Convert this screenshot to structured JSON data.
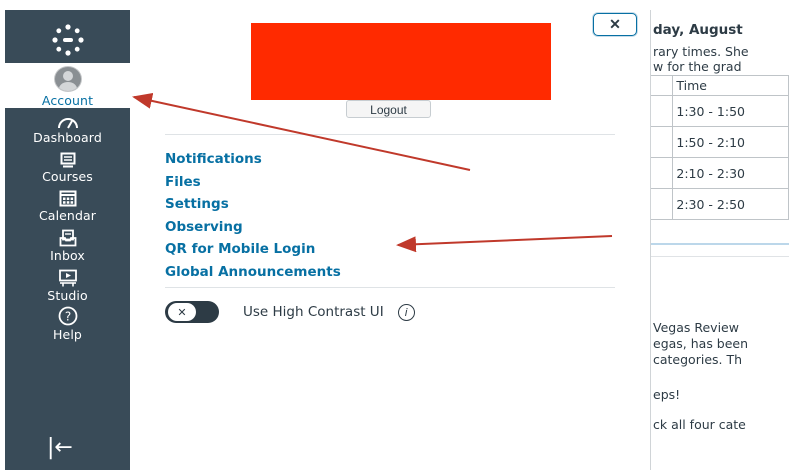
{
  "global_nav": {
    "items": [
      {
        "label": "Account",
        "icon": "account-avatar-icon"
      },
      {
        "label": "Dashboard",
        "icon": "dashboard-icon"
      },
      {
        "label": "Courses",
        "icon": "courses-icon"
      },
      {
        "label": "Calendar",
        "icon": "calendar-icon"
      },
      {
        "label": "Inbox",
        "icon": "inbox-icon"
      },
      {
        "label": "Studio",
        "icon": "studio-icon"
      },
      {
        "label": "Help",
        "icon": "help-icon"
      }
    ],
    "collapse_glyph": "|←"
  },
  "account_tray": {
    "logout_label": "Logout",
    "links": [
      "Notifications",
      "Files",
      "Settings",
      "Observing",
      "QR for Mobile Login",
      "Global Announcements"
    ],
    "high_contrast_label": "Use High Contrast UI",
    "toggle_knob": "✕",
    "info_glyph": "i"
  },
  "close_button": {
    "glyph": "✕"
  },
  "background_content": {
    "heading": "day, August",
    "line1": "rary times. She",
    "line2": "w for the grad",
    "table_header": "Time",
    "table_rows": [
      "1:30 - 1:50",
      "1:50 - 2:10",
      "2:10 - 2:30",
      "2:30 - 2:50"
    ],
    "para_title": "Vegas Review",
    "para_line1": "egas, has been",
    "para_line2": "categories. Th",
    "para_line3": "eps!",
    "para_line4": "ck all four cate"
  },
  "colors": {
    "nav_bg": "#394b58",
    "link_blue": "#0770a3",
    "redaction": "#ff2a00",
    "annotation_arrow": "#c0392b"
  }
}
